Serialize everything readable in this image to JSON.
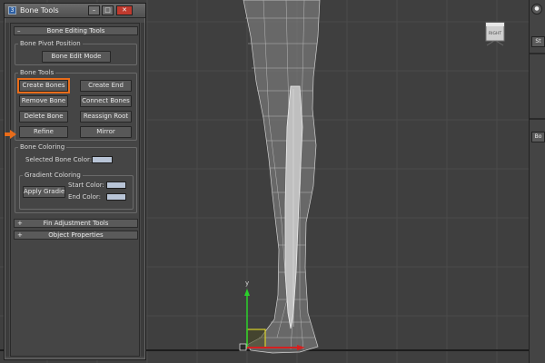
{
  "window": {
    "title": "Bone Tools",
    "icon_letter": "3",
    "minimize": "–",
    "maximize": "□",
    "close": "✕"
  },
  "rollouts": {
    "bone_editing": {
      "sign": "–",
      "title": "Bone Editing Tools"
    },
    "fin_adjustment": {
      "sign": "+",
      "title": "Fin Adjustment Tools"
    },
    "object_properties": {
      "sign": "+",
      "title": "Object Properties"
    }
  },
  "bone_pivot": {
    "label": "Bone Pivot Position",
    "edit_mode": "Bone Edit Mode"
  },
  "bone_tools": {
    "label": "Bone Tools",
    "create_bones": "Create Bones",
    "create_end": "Create End",
    "remove_bone": "Remove Bone",
    "connect_bones": "Connect Bones",
    "delete_bone": "Delete Bone",
    "reassign_root": "Reassign Root",
    "refine": "Refine",
    "mirror": "Mirror"
  },
  "bone_coloring": {
    "label": "Bone Coloring",
    "selected_color_label": "Selected Bone Color:",
    "gradient_label": "Gradient Coloring",
    "apply_gradient": "Apply Gradient",
    "start_color_label": "Start Color:",
    "end_color_label": "End Color:",
    "swatch_color": "#b8c4d6"
  },
  "viewport": {
    "viewcube_label": "RIGHT",
    "gizmo_axis_label": "y",
    "accent_color": "#e86c1a"
  },
  "right_strip": {
    "btn1": "St",
    "btn2": "Bo"
  }
}
